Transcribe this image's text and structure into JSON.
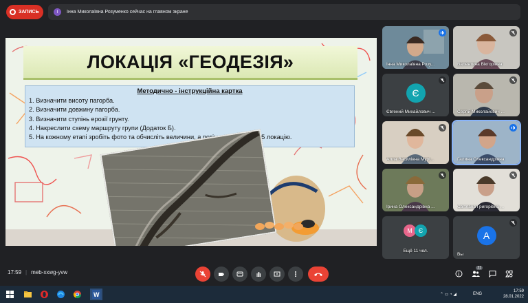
{
  "recording": {
    "label": "ЗАПИСЬ"
  },
  "notification": {
    "avatar_letter": "І",
    "text": "Інна Миколаївна Розуменко сейчас на главном экране"
  },
  "slide": {
    "title": "ЛОКАЦІЯ «ГЕОДЕЗІЯ»",
    "card_title": "Методично - інструкційна картка",
    "items": [
      "1. Визначити висоту пагорба.",
      "2. Визначити довжину пагорба.",
      "3. Визначити ступінь ерозії грунту.",
      "4. Накреслити схему маршруту групи (Додаток Б).",
      "5. На кожному етапі зробіть фото та обчисліть величини, а потім передайте на 5 локацію."
    ]
  },
  "participants": [
    {
      "name": "Інна Миколаївна Розу..."
    },
    {
      "name": "Валентина Вікторівна"
    },
    {
      "name": "Євгений Михайлович ...",
      "avatar_letter": "Є",
      "avatar_color": "#12a4af"
    },
    {
      "name": "Сергій Миколайович ..."
    },
    {
      "name": "Алла Василівна Мурі..."
    },
    {
      "name": "Галина Олександрівна"
    },
    {
      "name": "Ірина Олександрівна ..."
    },
    {
      "name": "Світлана Григорівна ..."
    },
    {
      "name": "Ещё 11 чел.",
      "avatar_letters": [
        "М",
        "Є"
      ],
      "avatar_colors": [
        "#e8668b",
        "#12a4af"
      ]
    },
    {
      "name": "Вы",
      "avatar_letter": "A",
      "avatar_color": "#1a73e8"
    }
  ],
  "toolbar": {
    "time": "17:59",
    "meeting_code": "meb-xxwg-yvw",
    "people_count": "21"
  },
  "taskbar": {
    "language": "ENG",
    "time": "17:59",
    "date": "28.01.2022"
  },
  "colors": {
    "meet_red": "#ea4335",
    "recording_red": "#d93025",
    "speaking_blue": "#1a73e8"
  }
}
